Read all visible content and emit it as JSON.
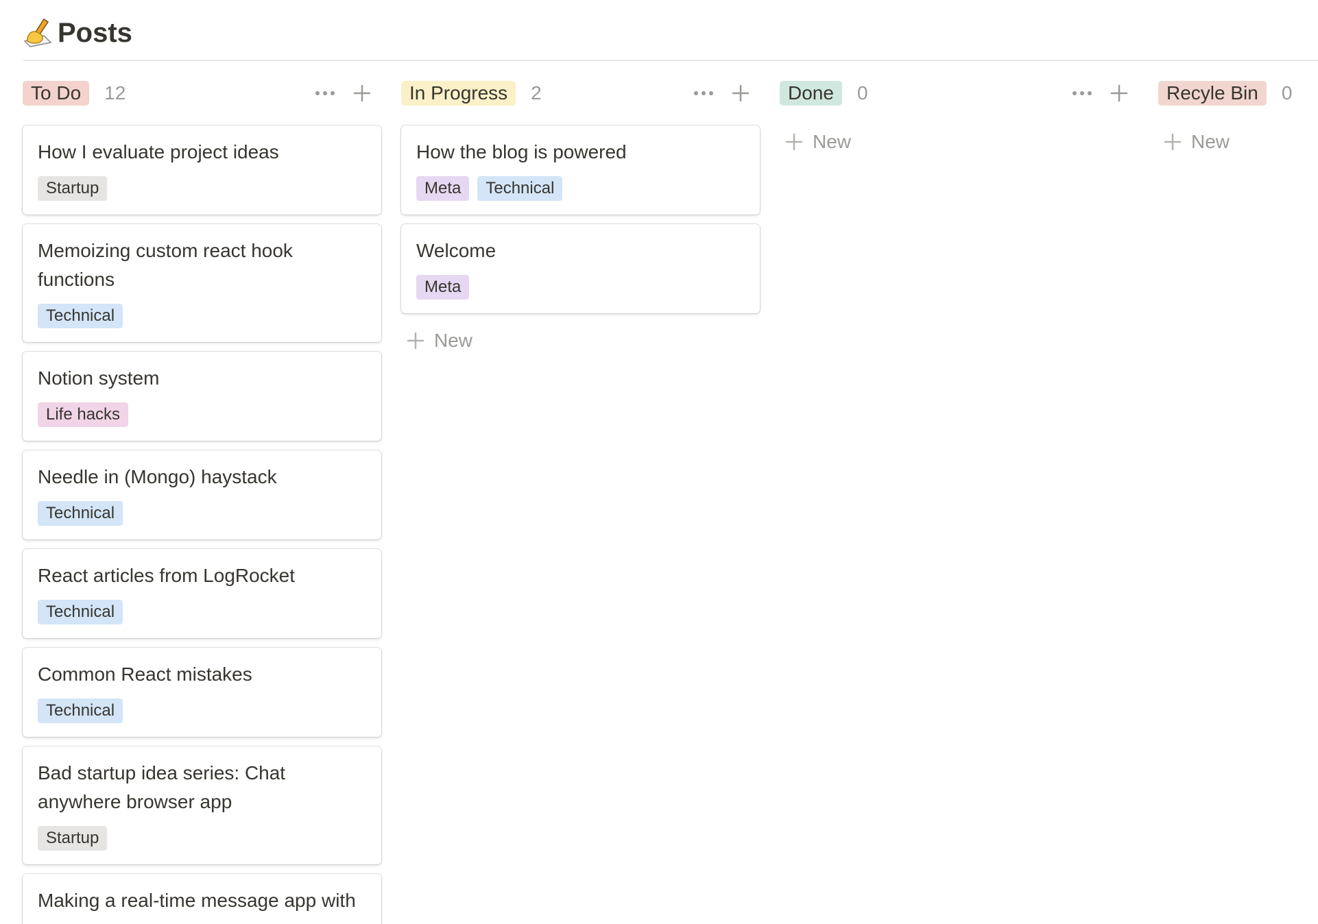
{
  "page": {
    "emoji": "✍️",
    "title": "Posts"
  },
  "colors": {
    "todo": "#f4d3cd",
    "inprogress": "#fbf0c8",
    "done": "#cfe7df",
    "recycle": "#f1d6cf",
    "tag_startup": "#e6e5e3",
    "tag_technical": "#d3e5f7",
    "tag_meta": "#e6d8f2",
    "tag_lifehacks": "#f1d4e8"
  },
  "columns": [
    {
      "label": "To Do",
      "count": "12",
      "cards": [
        {
          "title": "How I evaluate project ideas",
          "tags": [
            "Startup"
          ]
        },
        {
          "title": "Memoizing custom react hook functions",
          "tags": [
            "Technical"
          ]
        },
        {
          "title": "Notion system",
          "tags": [
            "Life hacks"
          ]
        },
        {
          "title": "Needle in (Mongo) haystack",
          "tags": [
            "Technical"
          ]
        },
        {
          "title": "React articles from LogRocket",
          "tags": [
            "Technical"
          ]
        },
        {
          "title": "Common React mistakes",
          "tags": [
            "Technical"
          ]
        },
        {
          "title": "Bad startup idea series: Chat anywhere browser app",
          "tags": [
            "Startup"
          ]
        },
        {
          "title": "Making a real-time message app with",
          "tags": []
        }
      ]
    },
    {
      "label": "In Progress",
      "count": "2",
      "cards": [
        {
          "title": "How the blog is powered",
          "tags": [
            "Meta",
            "Technical"
          ]
        },
        {
          "title": "Welcome",
          "tags": [
            "Meta"
          ]
        }
      ],
      "new_label": "New"
    },
    {
      "label": "Done",
      "count": "0",
      "cards": [],
      "new_label": "New"
    },
    {
      "label": "Recyle Bin",
      "count": "0",
      "cards": [],
      "new_label": "New"
    }
  ],
  "icons": {
    "more": "more-horizontal-icon",
    "add": "plus-icon"
  }
}
